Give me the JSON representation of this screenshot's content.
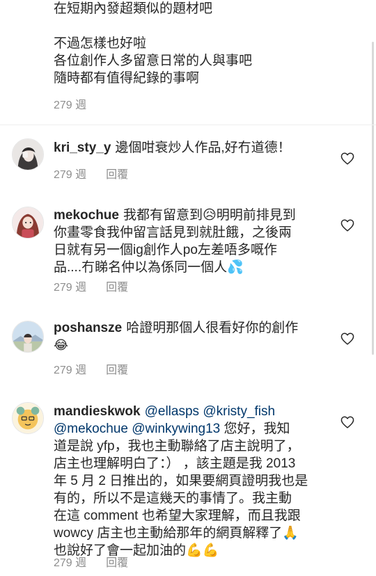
{
  "top_comment": {
    "lines": [
      "在短期內發超類似的題材吧",
      "不過怎樣也好啦",
      "各位創作人多留意日常的人與事吧",
      "隨時都有值得紀錄的事啊"
    ],
    "time": "279 週"
  },
  "comments": [
    {
      "username": "kri_sty_y",
      "lines": [
        "邊個咁衰炒人作品,好冇道德！"
      ],
      "time": "279 週",
      "reply_label": "回覆"
    },
    {
      "username": "mekochue",
      "lines": [
        "我都有留意到😥明明前排見到",
        "你畫零食我仲留言話見到就肚餓，之後兩",
        "日就有另一個ig創作人po左差唔多嘅作",
        "品....冇睇名仲以為係同一個人💦"
      ],
      "time": "279 週",
      "reply_label": "回覆"
    },
    {
      "username": "poshansze",
      "lines": [
        "哈證明那個人很看好你的創作",
        "😂"
      ],
      "time": "279 週",
      "reply_label": "回覆"
    },
    {
      "username": "mandieskwok",
      "mentions": [
        "@ellasps",
        "@kristy_fish",
        "@mekochue",
        "@winkywing13"
      ],
      "lines": [
        "您好，我知",
        "道是說 yfp，我也主動聯絡了店主說明了，",
        "店主也理解明白了：）  ，該主題是我 2013",
        "年 5 月 2 日推出的，如果要網頁證明我也是",
        "有的，所以不是這幾天的事情了。我主動",
        "在這 comment 也希望大家理解，而且我跟",
        "wowcy 店主也主動給那年的網頁解釋了🙏",
        "也說好了會一起加油的💪💪"
      ],
      "time": "279 週",
      "reply_label": "回覆"
    }
  ],
  "icons": {
    "like": "heart-outline-icon"
  },
  "colors": {
    "text": "#262626",
    "meta": "#8e8e8e",
    "mention": "#00376b",
    "divider": "#efefef"
  }
}
